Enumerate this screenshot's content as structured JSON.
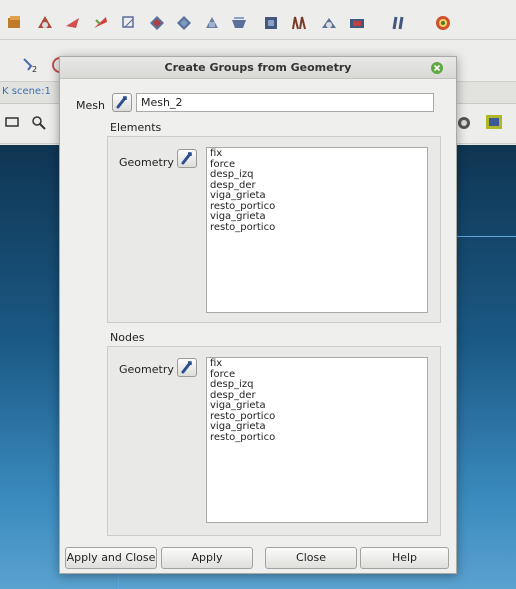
{
  "background": {
    "scene_tab": "K scene:1"
  },
  "dialog": {
    "title": "Create Groups from Geometry",
    "mesh": {
      "label": "Mesh",
      "value": "Mesh_2"
    },
    "elements": {
      "title": "Elements",
      "geometry_label": "Geometry",
      "items": [
        "fix",
        "force",
        "desp_izq",
        "desp_der",
        "viga_grieta",
        "resto_portico",
        "viga_grieta",
        "resto_portico"
      ]
    },
    "nodes": {
      "title": "Nodes",
      "geometry_label": "Geometry",
      "items": [
        "fix",
        "force",
        "desp_izq",
        "desp_der",
        "viga_grieta",
        "resto_portico",
        "viga_grieta",
        "resto_portico"
      ]
    },
    "buttons": {
      "apply_close": "Apply and Close",
      "apply": "Apply",
      "close": "Close",
      "help": "Help"
    }
  },
  "colors": {
    "dialog_bg": "#efefed",
    "viewport_top": "#0f3552",
    "viewport_bottom": "#5aa2d0",
    "close_icon": "#5fa843"
  }
}
